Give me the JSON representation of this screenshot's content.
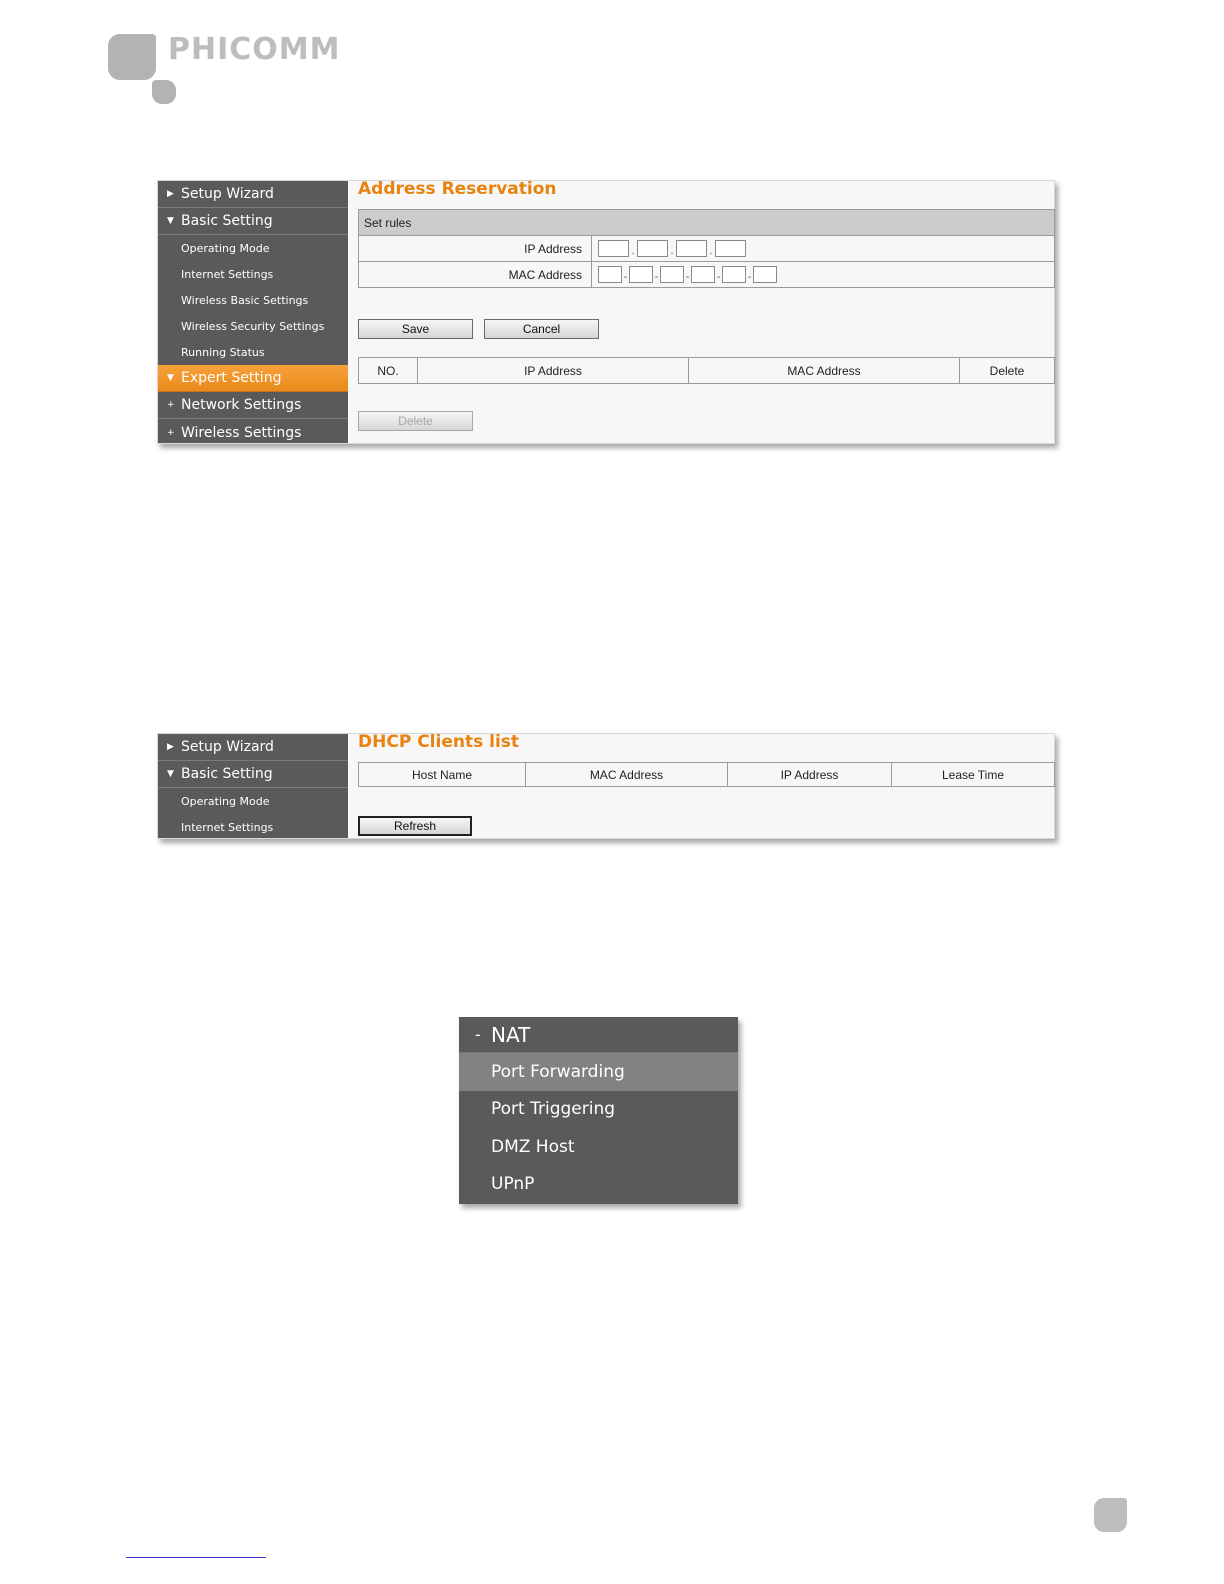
{
  "logo": {
    "brand": "PHICOMM"
  },
  "screen1": {
    "nav": {
      "items": [
        {
          "label": "Setup Wizard",
          "icon": "arrow-right"
        },
        {
          "label": "Basic Setting",
          "icon": "arrow-down"
        }
      ],
      "subitems": [
        "Operating Mode",
        "Internet Settings",
        "Wireless Basic Settings",
        "Wireless Security Settings",
        "Running Status"
      ],
      "after": [
        {
          "label": "Expert Setting",
          "icon": "arrow-down",
          "active": true
        },
        {
          "label": "Network Settings",
          "icon": "plus"
        },
        {
          "label": "Wireless Settings",
          "icon": "plus"
        }
      ]
    },
    "title": "Address Reservation",
    "set_rules": "Set rules",
    "ip_label": "IP Address",
    "mac_label": "MAC Address",
    "save": "Save",
    "cancel": "Cancel",
    "table_headers": [
      "NO.",
      "IP Address",
      "MAC Address",
      "Delete"
    ],
    "delete_button": "Delete"
  },
  "screen2": {
    "nav": {
      "items": [
        {
          "label": "Setup Wizard"
        },
        {
          "label": "Basic Setting"
        }
      ],
      "subitems": [
        "Operating Mode",
        "Internet Settings"
      ]
    },
    "title": "DHCP Clients list",
    "table_headers": [
      "Host Name",
      "MAC Address",
      "IP Address",
      "Lease Time"
    ],
    "refresh": "Refresh"
  },
  "nat_menu": {
    "header": "NAT",
    "items": [
      "Port Forwarding",
      "Port Triggering",
      "DMZ Host",
      "UPnP"
    ],
    "highlighted": "Port Forwarding"
  },
  "colors": {
    "accent": "#e8830f",
    "nav_bg": "#5a5a5a",
    "active_bg": "#f39a2e"
  }
}
